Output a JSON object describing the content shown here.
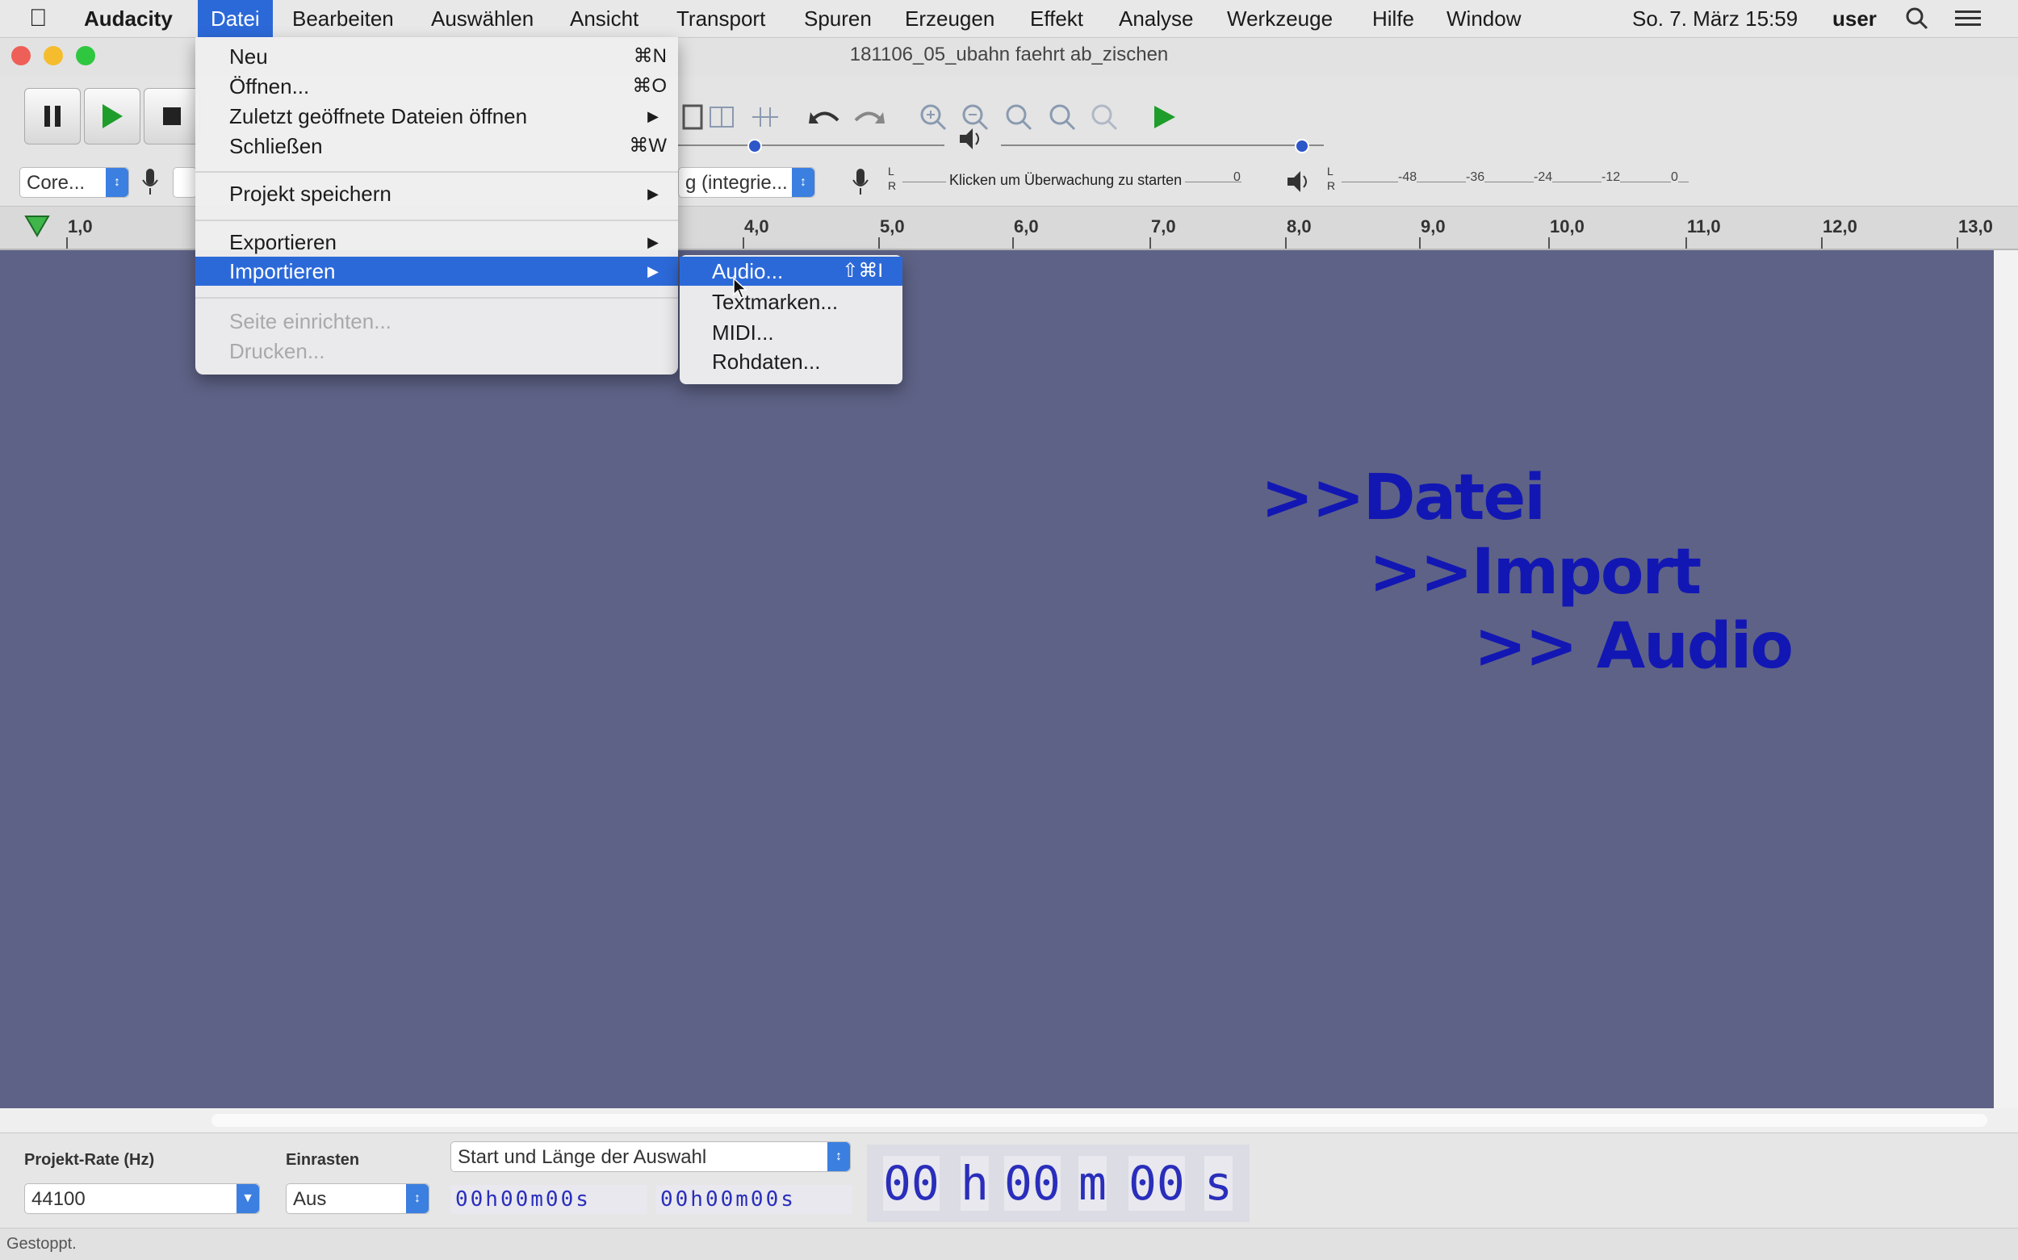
{
  "menubar": {
    "app": "Audacity",
    "items": [
      "Datei",
      "Bearbeiten",
      "Auswählen",
      "Ansicht",
      "Transport",
      "Spuren",
      "Erzeugen",
      "Effekt",
      "Analyse",
      "Werkzeuge",
      "Hilfe",
      "Window"
    ],
    "clock": "So. 7. März 15:59",
    "user": "user"
  },
  "window": {
    "title": "181106_05_ubahn faehrt ab_zischen"
  },
  "toolbar": {
    "host_select": "Core...",
    "channels_select": "g (integrie...",
    "meter_hint": "Klicken um Überwachung zu starten",
    "meter_ticks": [
      "-48",
      "-36",
      "-24",
      "-12",
      "0"
    ],
    "record_meter_zero": "0"
  },
  "ruler": {
    "labels": [
      "1,0",
      "4,0",
      "5,0",
      "6,0",
      "7,0",
      "8,0",
      "9,0",
      "10,0",
      "11,0",
      "12,0",
      "13,0"
    ]
  },
  "file_menu": {
    "items": [
      {
        "label": "Neu",
        "shortcut": "⌘N"
      },
      {
        "label": "Öffnen...",
        "shortcut": "⌘O"
      },
      {
        "label": "Zuletzt geöffnete Dateien öffnen",
        "submenu": true
      },
      {
        "label": "Schließen",
        "shortcut": "⌘W"
      },
      {
        "label": "Projekt speichern",
        "submenu": true
      },
      {
        "label": "Exportieren",
        "submenu": true
      },
      {
        "label": "Importieren",
        "submenu": true,
        "highlighted": true
      },
      {
        "label": "Seite einrichten...",
        "disabled": true
      },
      {
        "label": "Drucken...",
        "disabled": true
      }
    ]
  },
  "import_submenu": {
    "items": [
      {
        "label": "Audio...",
        "shortcut": "⇧⌘I",
        "highlighted": true
      },
      {
        "label": "Textmarken..."
      },
      {
        "label": "MIDI..."
      },
      {
        "label": "Rohdaten..."
      }
    ]
  },
  "annotation": {
    "line1": ">>Datei",
    "line2": ">>Import",
    "line3": ">> Audio"
  },
  "bottom": {
    "rate_label": "Projekt-Rate (Hz)",
    "rate_value": "44100",
    "snap_label": "Einrasten",
    "snap_value": "Aus",
    "selection_mode": "Start und Länge der Auswahl",
    "sel_start": "00h00m00s",
    "sel_length": "00h00m00s",
    "audio_pos": {
      "h": "00",
      "m": "00",
      "s": "00",
      "uh": "h",
      "um": "m",
      "us": "s"
    }
  },
  "status": {
    "text": "Gestoppt."
  },
  "colors": {
    "track_bg": "#5e6286",
    "menu_highlight": "#2c69d8",
    "annotation": "#1217b4"
  }
}
